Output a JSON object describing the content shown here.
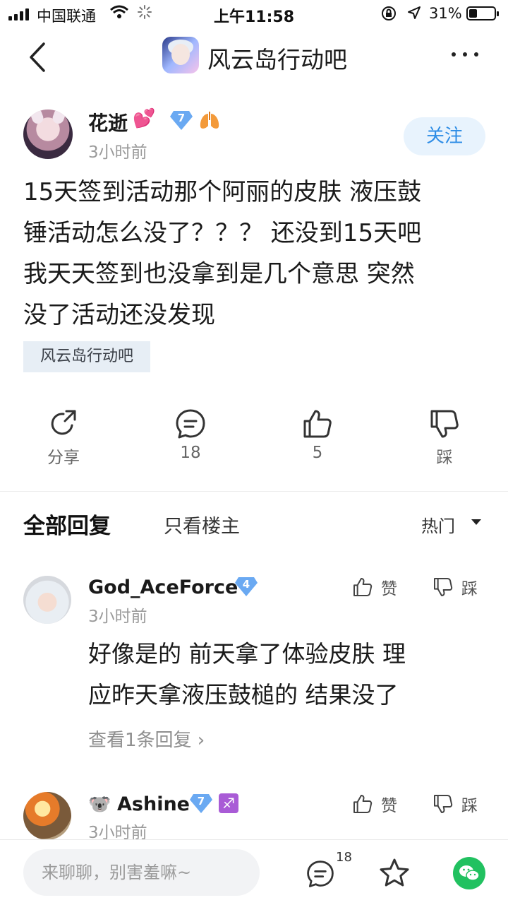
{
  "status_bar": {
    "carrier": "中国联通",
    "time": "上午11:58",
    "battery": "31%",
    "battery_level": 0.31
  },
  "nav": {
    "forum_title": "风云岛行动吧"
  },
  "post": {
    "author": "花逝",
    "level": "7",
    "time": "3小时前",
    "follow_label": "关注",
    "body_lines": [
      "15天签到活动那个阿丽的皮肤 液压鼓",
      "锤活动怎么没了？？？ 还没到15天吧",
      "我天天签到也没拿到是几个意思 突然",
      "没了活动还没发现"
    ],
    "tag": "风云岛行动吧"
  },
  "actions": {
    "share": "分享",
    "comments": "18",
    "likes": "5",
    "dislike": "踩"
  },
  "replies_header": {
    "title": "全部回复",
    "only_op": "只看楼主",
    "sort": "热门"
  },
  "replies": [
    {
      "name": "God_AceForce",
      "level": "4",
      "time": "3小时前",
      "like_label": "赞",
      "dislike_label": "踩",
      "body_lines": [
        "好像是的 前天拿了体验皮肤 理",
        "应昨天拿液压鼓槌的 结果没了"
      ],
      "view_replies": "查看1条回复 ›"
    },
    {
      "name": "Ashine",
      "level": "7",
      "time": "3小时前",
      "like_label": "赞",
      "dislike_label": "踩"
    }
  ],
  "bottom_bar": {
    "input_placeholder": "来聊聊，别害羞嘛~",
    "comment_count": "18"
  },
  "colors": {
    "accent": "#2e8de6",
    "badge_blue": "#6aa9f2",
    "wechat": "#21c160"
  }
}
